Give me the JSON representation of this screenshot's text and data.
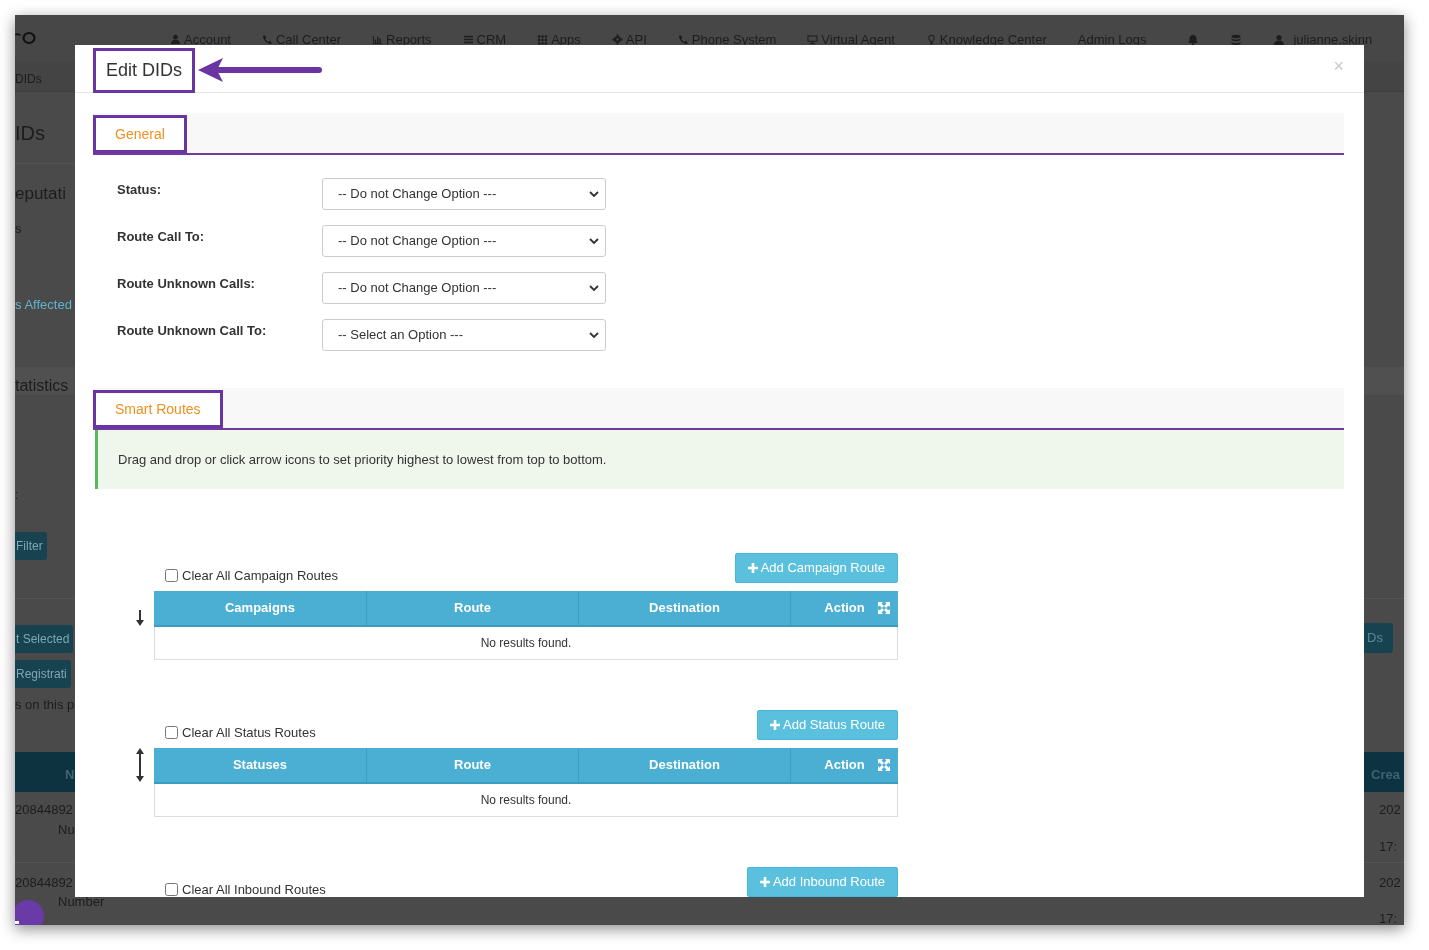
{
  "background": {
    "nav": [
      {
        "label": "Account"
      },
      {
        "label": "Call Center"
      },
      {
        "label": "Reports"
      },
      {
        "label": "CRM"
      },
      {
        "label": "Apps"
      },
      {
        "label": "API"
      },
      {
        "label": "Phone System"
      },
      {
        "label": "Virtual Agent"
      },
      {
        "label": "Knowledge Center"
      },
      {
        "label": "Admin Logs"
      }
    ],
    "user": "julianne.skinn",
    "breadcrumb": "DIDs",
    "left": [
      {
        "kind": "title",
        "text": "IDs"
      },
      {
        "kind": "heading",
        "text": "eputati"
      },
      {
        "kind": "text",
        "text": "s"
      },
      {
        "kind": "link",
        "text": "s Affected"
      },
      {
        "kind": "band",
        "text": "tatistics"
      },
      {
        "kind": "text",
        "text": ":"
      },
      {
        "kind": "button",
        "text": "Filter"
      },
      {
        "kind": "button",
        "text": "t Selected"
      },
      {
        "kind": "button",
        "text": "Registrati"
      },
      {
        "kind": "text",
        "text": "s on this p"
      },
      {
        "kind": "header",
        "text": "N"
      },
      {
        "kind": "text",
        "text": "20844892"
      },
      {
        "kind": "text",
        "text": "Nu"
      },
      {
        "kind": "text",
        "text": "20844892"
      },
      {
        "kind": "text",
        "text": "Number"
      }
    ],
    "right": [
      {
        "kind": "button",
        "text": "Ds"
      },
      {
        "kind": "header",
        "text": "Crea"
      },
      {
        "kind": "text",
        "text": "202"
      },
      {
        "kind": "text",
        "text": "17:"
      },
      {
        "kind": "text",
        "text": "202"
      },
      {
        "kind": "text",
        "text": "17:"
      }
    ]
  },
  "modal": {
    "title": "Edit DIDs",
    "close": "×",
    "general": {
      "tab": "General",
      "fields": [
        {
          "label": "Status:",
          "value": "-- Do not Change Option ---"
        },
        {
          "label": "Route Call To:",
          "value": "-- Do not Change Option ---"
        },
        {
          "label": "Route Unknown Calls:",
          "value": "-- Do not Change Option ---"
        },
        {
          "label": "Route Unknown Call To:",
          "value": "-- Select an Option ---"
        }
      ]
    },
    "smart_routes": {
      "tab": "Smart Routes",
      "notice": "Drag and drop or click arrow icons to set priority highest to lowest from top to bottom.",
      "tables": [
        {
          "kind": "down",
          "checkbox_label": "Clear All Campaign Routes",
          "checked": false,
          "button": "Add Campaign Route",
          "columns": [
            "Campaigns",
            "Route",
            "Destination",
            "Action"
          ],
          "empty": "No results found."
        },
        {
          "kind": "both",
          "checkbox_label": "Clear All Status Routes",
          "checked": false,
          "button": "Add Status Route",
          "columns": [
            "Statuses",
            "Route",
            "Destination",
            "Action"
          ],
          "empty": "No results found."
        },
        {
          "kind": "none",
          "checkbox_label": "Clear All Inbound Routes",
          "checked": false,
          "button": "Add Inbound Route"
        }
      ]
    }
  }
}
